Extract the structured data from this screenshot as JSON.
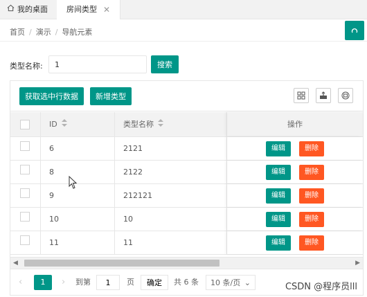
{
  "tabs": {
    "home_label": "我的桌面",
    "active_label": "房间类型",
    "close_glyph": "✕"
  },
  "breadcrumb": {
    "items": [
      "首页",
      "演示",
      "导航元素"
    ],
    "separator": "/"
  },
  "search": {
    "label": "类型名称:",
    "value": "1",
    "button": "搜索"
  },
  "toolbar": {
    "get_selected": "获取选中行数据",
    "add_type": "新增类型",
    "icons": [
      "columns-icon",
      "export-icon",
      "print-icon"
    ]
  },
  "table": {
    "headers": {
      "id": "ID",
      "name": "类型名称",
      "ops": "操作"
    },
    "rows": [
      {
        "id": "6",
        "name": "2121"
      },
      {
        "id": "8",
        "name": "2122"
      },
      {
        "id": "9",
        "name": "212121"
      },
      {
        "id": "10",
        "name": "10"
      },
      {
        "id": "11",
        "name": "11"
      }
    ],
    "edit_label": "编辑",
    "delete_label": "删除"
  },
  "pager": {
    "current": "1",
    "goto_label": "到第",
    "goto_value": "1",
    "page_unit": "页",
    "confirm": "确定",
    "total": "共 6 条",
    "page_size": "10 条/页"
  },
  "watermark": "CSDN @程序员lll",
  "colors": {
    "primary": "#009688",
    "danger": "#ff5722"
  }
}
